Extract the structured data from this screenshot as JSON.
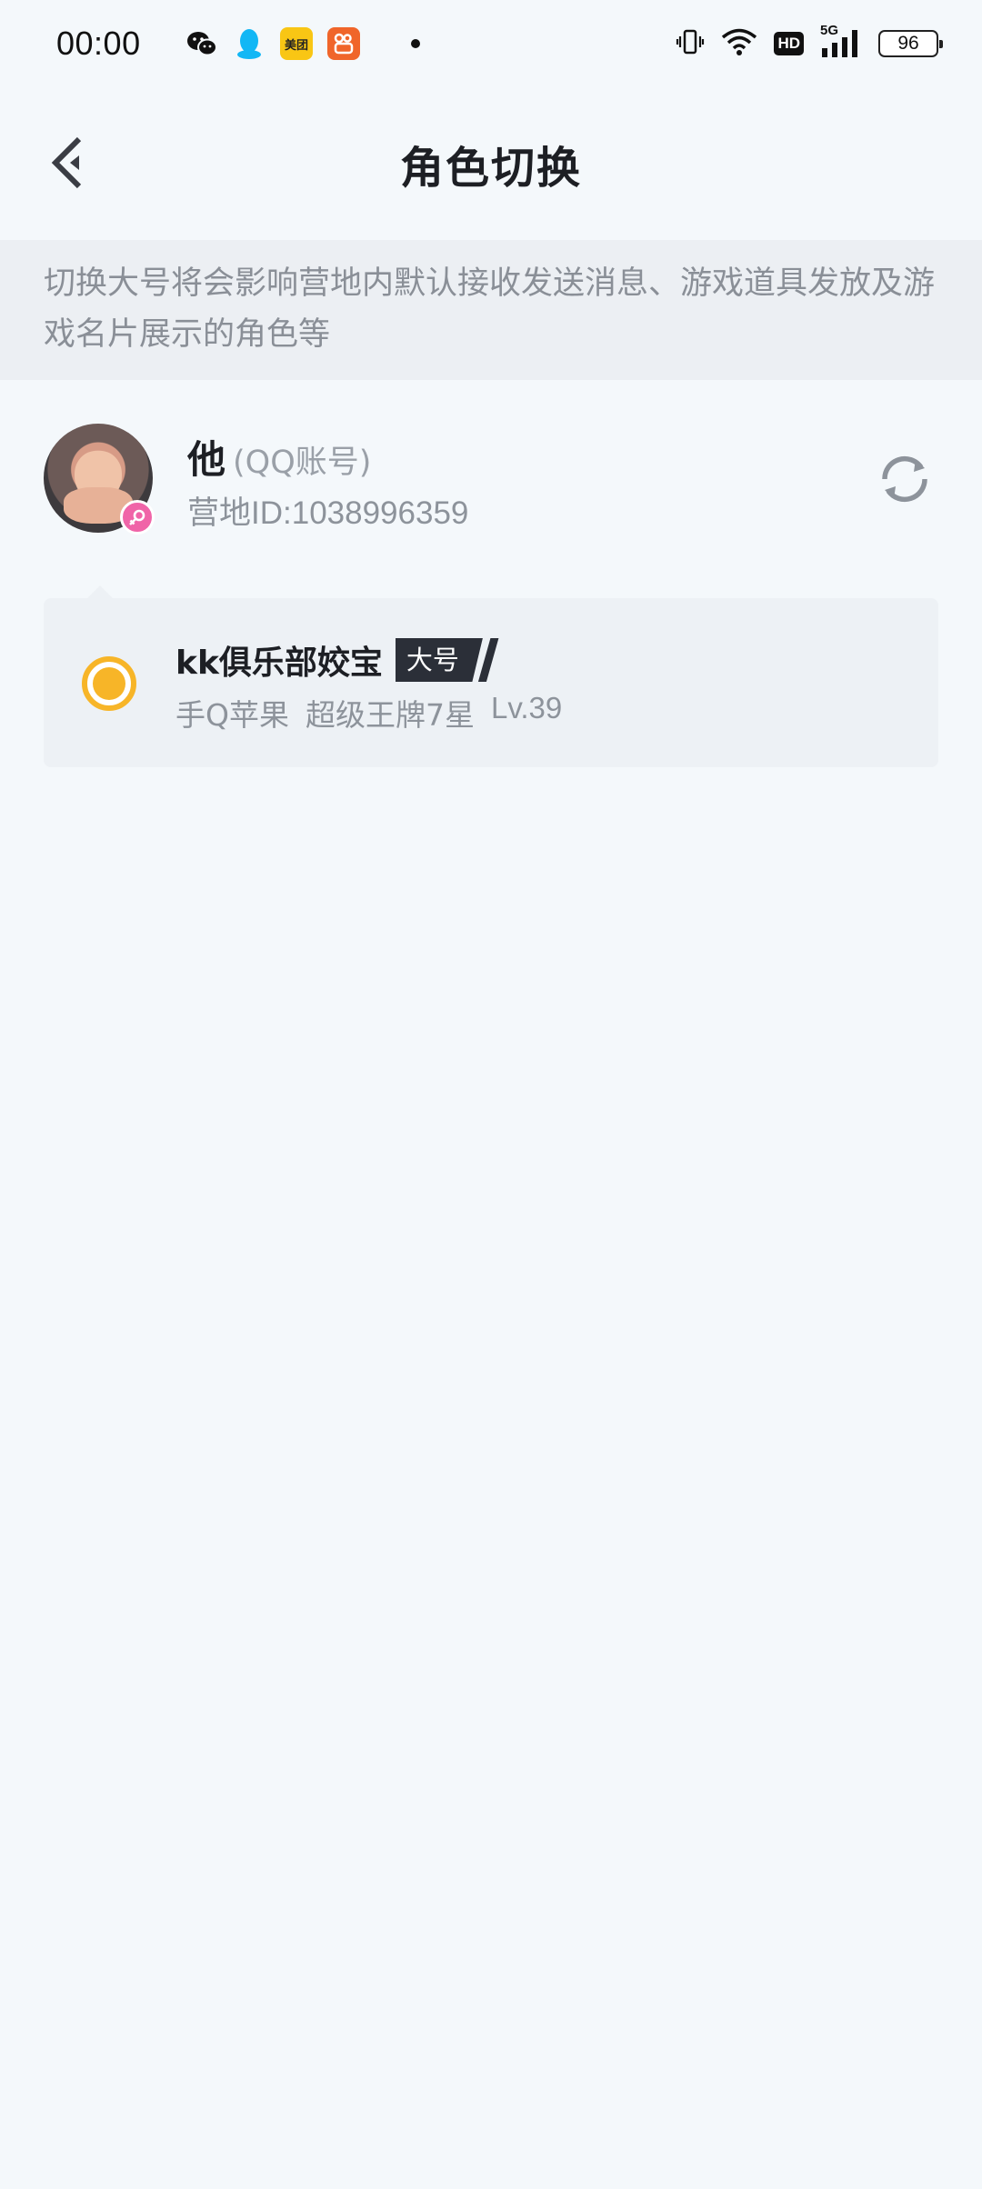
{
  "status_bar": {
    "time": "00:00",
    "apps": [
      "wechat-icon",
      "qq-icon",
      "meituan-icon",
      "kuaishou-icon"
    ],
    "meituan_label": "美团",
    "hd_label": "HD",
    "network_label": "5G",
    "battery": "96"
  },
  "header": {
    "title": "角色切换"
  },
  "notice": {
    "text": "切换大号将会影响营地内默认接收发送消息、游戏道具发放及游戏名片展示的角色等"
  },
  "account": {
    "name": "他",
    "type": "(QQ账号)",
    "camp_id": "营地ID:1038996359",
    "gender_icon": "female-icon"
  },
  "roles": [
    {
      "name": "kk俱乐部姣宝",
      "tag": "大号",
      "platform": "手Q苹果",
      "rank": "超级王牌7星",
      "level": "Lv.39",
      "selected": true
    }
  ],
  "colors": {
    "accent": "#f7b528",
    "background": "#f4f8fb",
    "card": "#edf1f5",
    "tag_bg": "#2b2f38",
    "gender": "#f064a8"
  }
}
